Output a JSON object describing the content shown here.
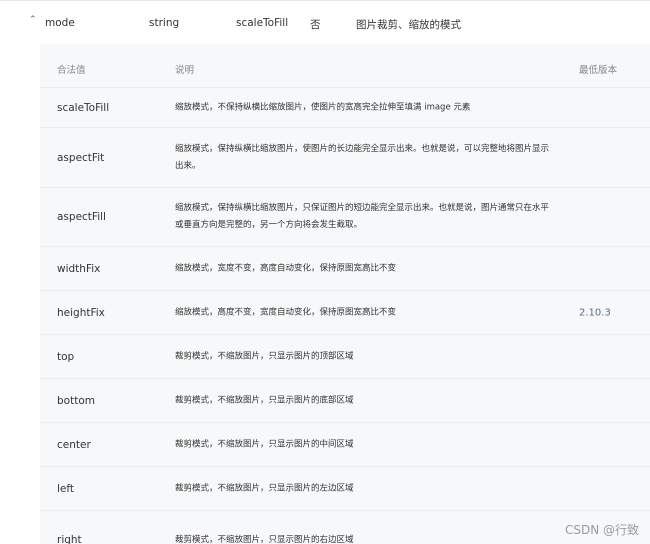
{
  "prop": {
    "expand_icon": "chevron-up-icon",
    "name": "mode",
    "type": "string",
    "default": "scaleToFill",
    "required": "否",
    "description": "图片裁剪、缩放的模式"
  },
  "subtable": {
    "headers": {
      "value": "合法值",
      "desc": "说明",
      "version": "最低版本"
    },
    "rows": [
      {
        "value": "scaleToFill",
        "desc": "缩放模式，不保持纵横比缩放图片，使图片的宽高完全拉伸至填满 image 元素",
        "version": ""
      },
      {
        "value": "aspectFit",
        "desc": "缩放模式，保持纵横比缩放图片，使图片的长边能完全显示出来。也就是说，可以完整地将图片显示出来。",
        "version": ""
      },
      {
        "value": "aspectFill",
        "desc": "缩放模式，保持纵横比缩放图片，只保证图片的短边能完全显示出来。也就是说，图片通常只在水平或垂直方向是完整的，另一个方向将会发生截取。",
        "version": ""
      },
      {
        "value": "widthFix",
        "desc": "缩放模式，宽度不变，高度自动变化，保持原图宽高比不变",
        "version": ""
      },
      {
        "value": "heightFix",
        "desc": "缩放模式，高度不变，宽度自动变化，保持原图宽高比不变",
        "version": "2.10.3"
      },
      {
        "value": "top",
        "desc": "裁剪模式，不缩放图片，只显示图片的顶部区域",
        "version": ""
      },
      {
        "value": "bottom",
        "desc": "裁剪模式，不缩放图片，只显示图片的底部区域",
        "version": ""
      },
      {
        "value": "center",
        "desc": "裁剪模式，不缩放图片，只显示图片的中间区域",
        "version": ""
      },
      {
        "value": "left",
        "desc": "裁剪模式，不缩放图片，只显示图片的左边区域",
        "version": ""
      },
      {
        "value": "right",
        "desc": "裁剪模式，不缩放图片，只显示图片的右边区域",
        "version": ""
      }
    ]
  },
  "watermark": "CSDN @行致"
}
